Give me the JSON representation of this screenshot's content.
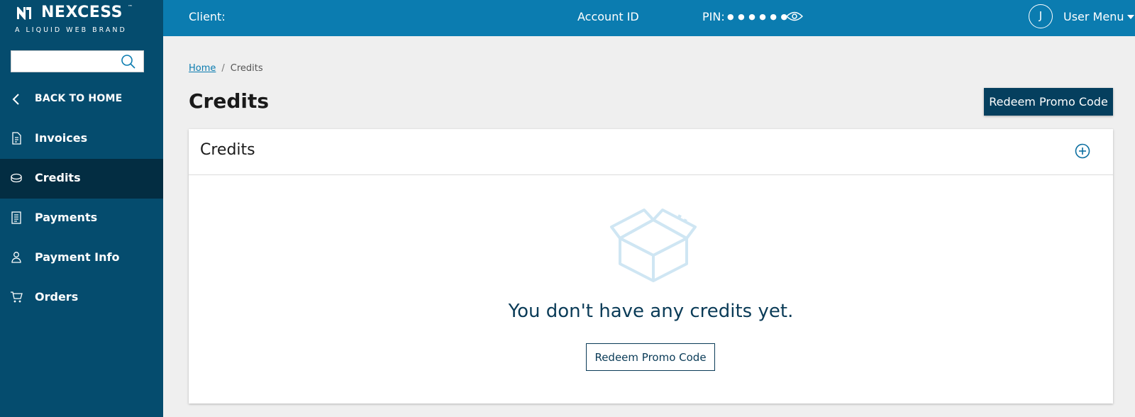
{
  "brand": {
    "name": "NEXCESS",
    "trademark": "™",
    "tagline": "A LIQUID WEB BRAND"
  },
  "sidebar": {
    "search_value": "",
    "back_label": "BACK TO HOME",
    "items": [
      {
        "label": "Invoices",
        "icon": "invoice-icon",
        "active": false
      },
      {
        "label": "Credits",
        "icon": "coin-stack-icon",
        "active": true
      },
      {
        "label": "Payments",
        "icon": "receipt-icon",
        "active": false
      },
      {
        "label": "Payment Info",
        "icon": "user-card-icon",
        "active": false
      },
      {
        "label": "Orders",
        "icon": "cart-icon",
        "active": false
      }
    ]
  },
  "topbar": {
    "client_label": "Client:",
    "client_value": ".",
    "account_id_label": "Account ID",
    "pin_label": "PIN:",
    "pin_value": "● ● ● ● ● ●",
    "avatar_initial": "J",
    "user_menu_label": "User Menu"
  },
  "breadcrumb": {
    "home": "Home",
    "separator": "/",
    "current": "Credits"
  },
  "page": {
    "title": "Credits",
    "redeem_button": "Redeem Promo Code"
  },
  "card": {
    "title": "Credits",
    "empty_message": "You don't have any credits yet.",
    "redeem_button": "Redeem Promo Code"
  },
  "colors": {
    "sidebar_bg": "#054c6e",
    "sidebar_active": "#032d42",
    "topbar_bg": "#0b7cb0",
    "primary_button": "#053f5e",
    "empty_text": "#0a3b57",
    "box_icon": "#cfe6f3"
  }
}
